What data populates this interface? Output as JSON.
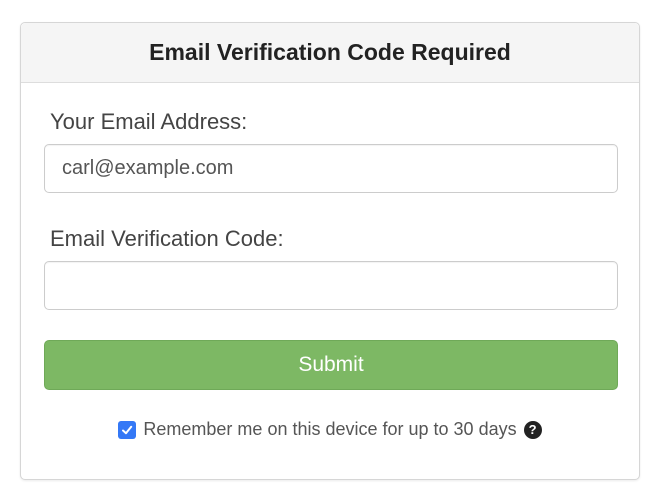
{
  "panel": {
    "title": "Email Verification Code Required"
  },
  "form": {
    "email_label": "Your Email Address:",
    "email_value": "carl@example.com",
    "code_label": "Email Verification Code:",
    "code_value": "",
    "submit_label": "Submit"
  },
  "remember": {
    "checked": true,
    "label": "Remember me on this device for up to 30 days",
    "help_icon": "question-circle-icon",
    "help_glyph": "?"
  },
  "colors": {
    "submit_bg": "#7db864",
    "checkbox_bg": "#3478f6",
    "heading_bg": "#f5f5f5"
  }
}
